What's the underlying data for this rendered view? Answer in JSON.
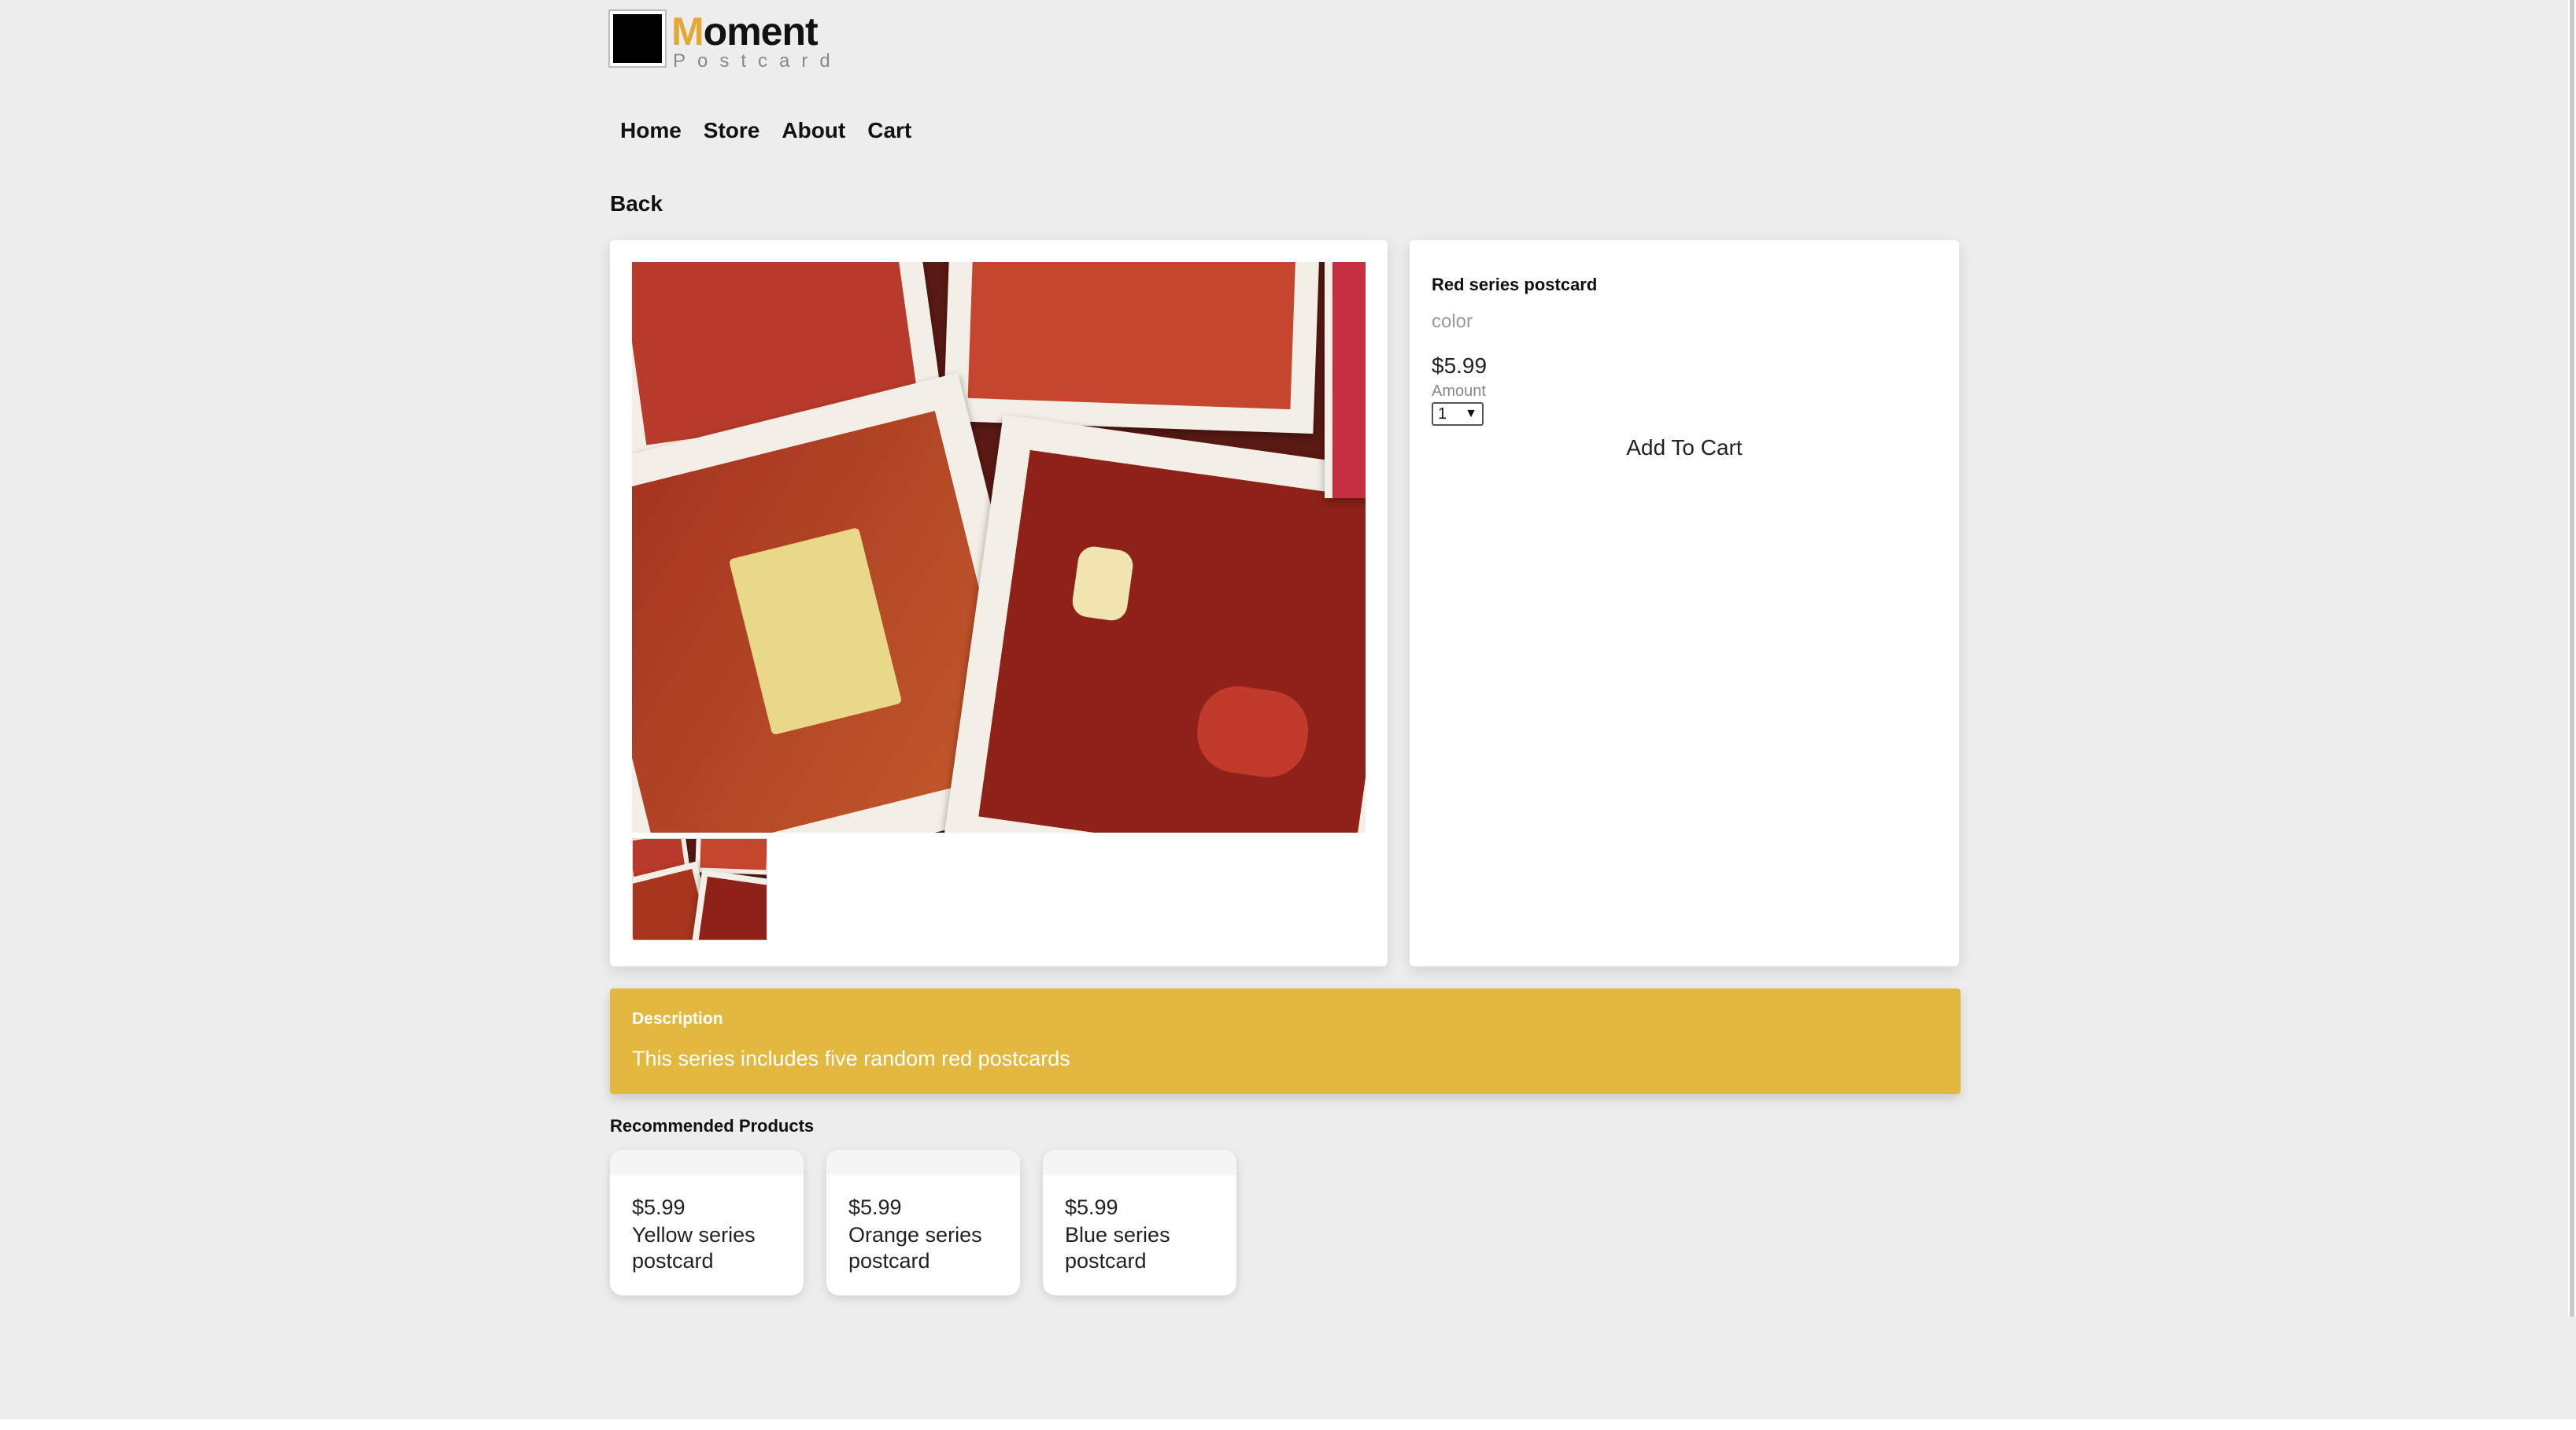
{
  "brand": {
    "name": "Moment",
    "tagline": "Postcard",
    "accent": "#e2a735"
  },
  "nav": {
    "items": [
      "Home",
      "Store",
      "About",
      "Cart"
    ]
  },
  "back_label": "Back",
  "product": {
    "name": "Red series postcard",
    "color_label": "color",
    "price": "$5.99",
    "amount_label": "Amount",
    "amount_value": "1",
    "add_to_cart": "Add To Cart"
  },
  "description": {
    "title": "Description",
    "text": "This series includes five random red postcards",
    "bg": "#e3b83f"
  },
  "recommended": {
    "title": "Recommended Products",
    "items": [
      {
        "price": "$5.99",
        "name": "Yellow series postcard"
      },
      {
        "price": "$5.99",
        "name": "Orange series postcard"
      },
      {
        "price": "$5.99",
        "name": "Blue series postcard"
      }
    ]
  }
}
